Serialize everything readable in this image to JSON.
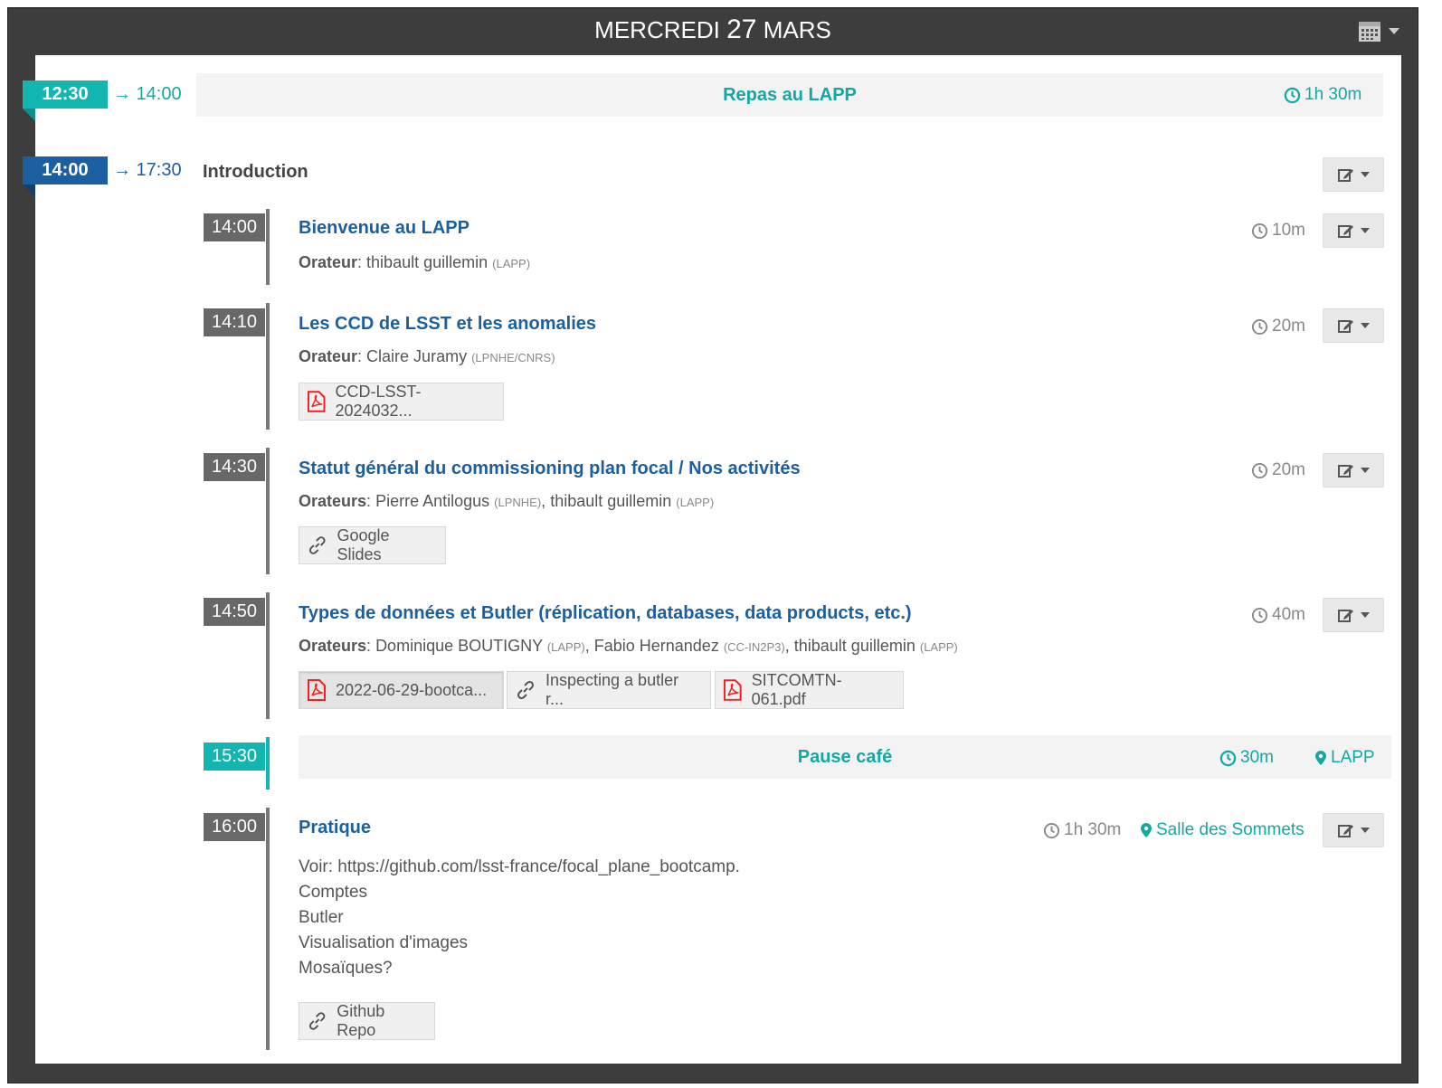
{
  "header": {
    "weekday": "MERCREDI",
    "day": "27",
    "month": "MARS"
  },
  "colors": {
    "teal": "#13b5b1",
    "blue": "#1c5fa0",
    "gray": "#686868"
  },
  "lunch": {
    "start": "12:30",
    "end": "→ 14:00",
    "title": "Repas au LAPP",
    "duration": "1h 30m"
  },
  "session": {
    "start": "14:00",
    "end": "→ 17:30",
    "title": "Introduction"
  },
  "contributions": [
    {
      "time": "14:00",
      "title": "Bienvenue au LAPP",
      "duration": "10m",
      "speaker_label": "Orateur",
      "speakers": [
        {
          "name": "thibault guillemin",
          "aff": "(LAPP)"
        }
      ]
    },
    {
      "time": "14:10",
      "title": "Les CCD de LSST et les anomalies",
      "duration": "20m",
      "speaker_label": "Orateur",
      "speakers": [
        {
          "name": "Claire Juramy",
          "aff": "(LPNHE/CNRS)"
        }
      ],
      "materials": [
        {
          "label": "CCD-LSST-2024032...",
          "icon": "pdf-icon"
        }
      ]
    },
    {
      "time": "14:30",
      "title": "Statut général du commissioning plan focal / Nos activités",
      "duration": "20m",
      "speaker_label": "Orateurs",
      "speakers": [
        {
          "name": "Pierre Antilogus",
          "aff": "(LPNHE)"
        },
        {
          "name": "thibault guillemin",
          "aff": "(LAPP)"
        }
      ],
      "materials": [
        {
          "label": "Google Slides",
          "icon": "link-icon"
        }
      ]
    },
    {
      "time": "14:50",
      "title": "Types de données et Butler (réplication, databases, data products, etc.)",
      "duration": "40m",
      "speaker_label": "Orateurs",
      "speakers": [
        {
          "name": "Dominique BOUTIGNY",
          "aff": "(LAPP)"
        },
        {
          "name": "Fabio Hernandez",
          "aff": "(CC-IN2P3)"
        },
        {
          "name": "thibault guillemin",
          "aff": "(LAPP)"
        }
      ],
      "materials": [
        {
          "label": "2022-06-29-bootca...",
          "icon": "pdf-icon"
        },
        {
          "label": "Inspecting a butler r...",
          "icon": "link-icon"
        },
        {
          "label": "SITCOMTN-061.pdf",
          "icon": "pdf-icon"
        }
      ]
    }
  ],
  "coffee": {
    "time": "15:30",
    "title": "Pause café",
    "duration": "30m",
    "location": "LAPP"
  },
  "pratique": {
    "time": "16:00",
    "title": "Pratique",
    "duration": "1h 30m",
    "location": "Salle des Sommets",
    "description": [
      "Voir: https://github.com/lsst-france/focal_plane_bootcamp.",
      "Comptes",
      "Butler",
      "Visualisation d'images",
      "Mosaïques?"
    ],
    "materials": [
      {
        "label": "Github Repo",
        "icon": "link-icon"
      }
    ]
  }
}
